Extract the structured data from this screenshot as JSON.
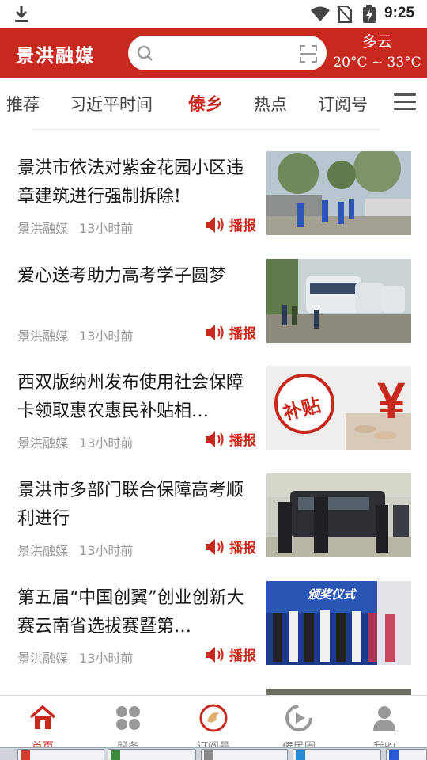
{
  "status_bar": {
    "time": "9:25",
    "icons": [
      "download-icon",
      "wifi-icon",
      "no-sim-icon",
      "battery-charging-icon"
    ]
  },
  "header": {
    "logo": "景洪融媒",
    "search": {
      "placeholder": "",
      "value": ""
    },
    "weather": {
      "condition": "多云",
      "temperature": "20°C ~ 33°C"
    }
  },
  "tabs": {
    "items": [
      {
        "label": "推荐"
      },
      {
        "label": "习近平时间"
      },
      {
        "label": "傣乡",
        "active": true
      },
      {
        "label": "热点"
      },
      {
        "label": "订阅号"
      }
    ],
    "menu_icon": "hamburger-menu-icon"
  },
  "articles": [
    {
      "title": "景洪市依法对紫金花园小区违章建筑进行强制拆除!",
      "source": "景洪融媒",
      "time": "13小时前",
      "play_label": "播报",
      "thumb": "demolition-scene"
    },
    {
      "title": "爱心送考助力高考学子圆梦",
      "source": "景洪融媒",
      "time": "13小时前",
      "play_label": "播报",
      "thumb": "buses"
    },
    {
      "title": "西双版纳州发布使用社会保障卡领取惠农惠民补贴相…",
      "source": "景洪融媒",
      "time": "13小时前",
      "play_label": "播报",
      "thumb": "subsidy",
      "thumb_text": "补贴"
    },
    {
      "title": "景洪市多部门联合保障高考顺利进行",
      "source": "景洪融媒",
      "time": "13小时前",
      "play_label": "播报",
      "thumb": "police"
    },
    {
      "title": "第五届“中国创翼”创业创新大赛云南省选拔赛暨第…",
      "source": "景洪融媒",
      "time": "13小时前",
      "play_label": "播报",
      "thumb": "award-ceremony",
      "thumb_text": "颁奖仪式"
    }
  ],
  "bottom_nav": [
    {
      "label": "首页",
      "icon": "home-icon",
      "active": true
    },
    {
      "label": "服务",
      "icon": "services-icon"
    },
    {
      "label": "订阅号",
      "icon": "subscription-icon"
    },
    {
      "label": "傣民圈",
      "icon": "circle-play-icon"
    },
    {
      "label": "我的",
      "icon": "user-icon"
    }
  ],
  "colors": {
    "brand": "#c8281e",
    "text": "#1a1a1a",
    "meta": "#999999"
  }
}
